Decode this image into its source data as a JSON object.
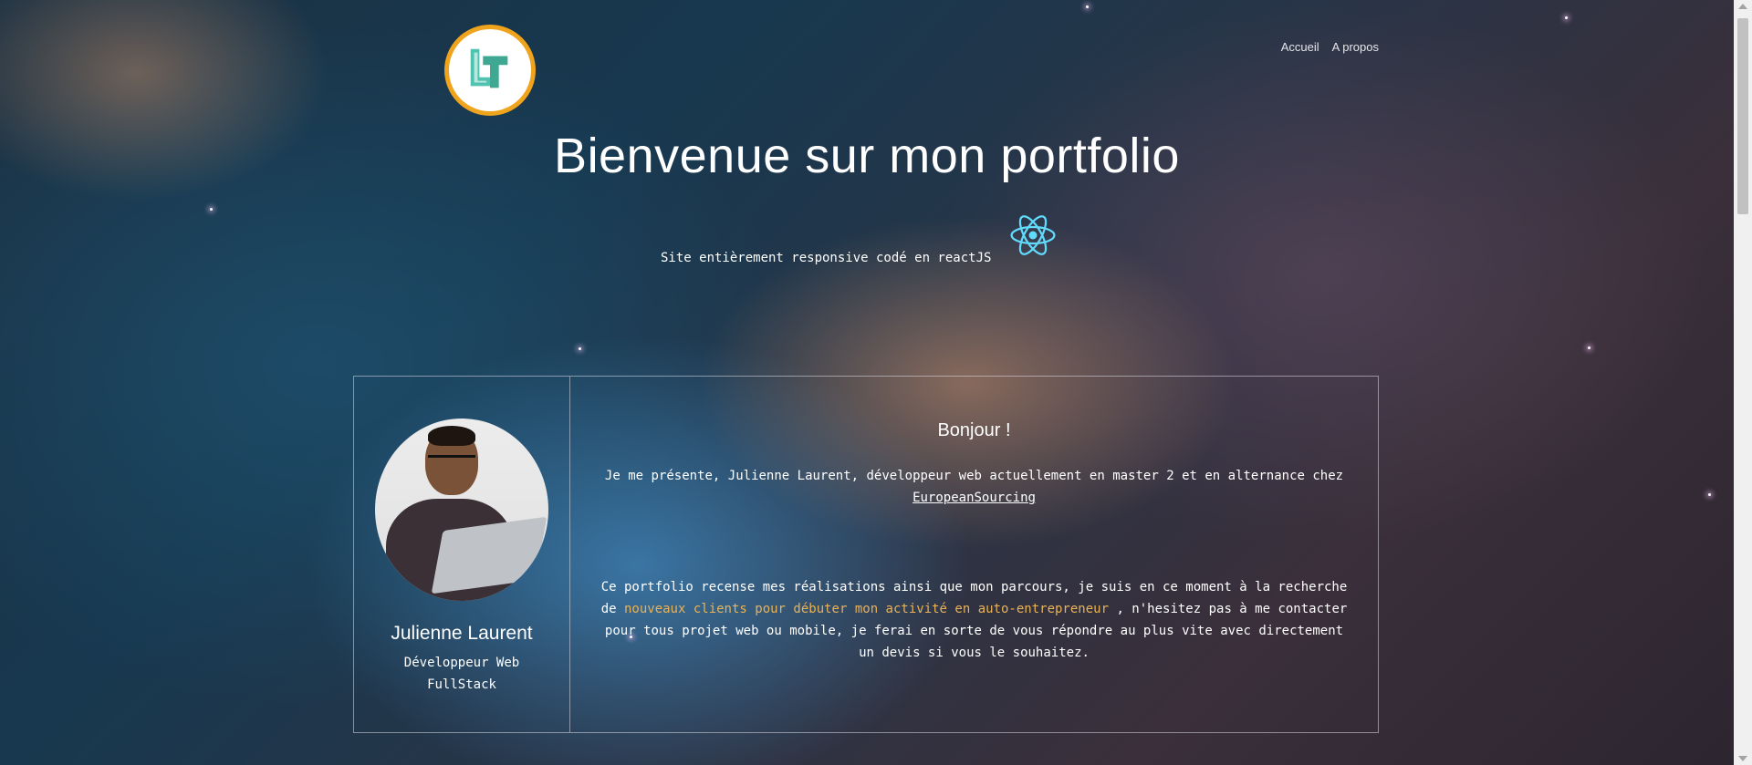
{
  "header": {
    "logo_icon": "lt-monogram-logo",
    "nav": [
      {
        "label": "Accueil"
      },
      {
        "label": "A propos"
      }
    ]
  },
  "hero": {
    "title": "Bienvenue sur mon portfolio",
    "subtitle": "Site entièrement responsive codé en reactJS",
    "tech_icon": "react-atom-icon"
  },
  "profile": {
    "name": "Julienne Laurent",
    "role": "Développeur Web FullStack"
  },
  "about": {
    "greeting": "Bonjour !",
    "intro_text": "Je me présente, Julienne Laurent, développeur web actuellement en master 2 et en alternance chez",
    "company": "EuropeanSourcing",
    "paragraph_start": "Ce portfolio recense mes réalisations ainsi que mon parcours, je suis en ce moment à la recherche de",
    "highlight": "nouveaux clients pour débuter mon activité en auto-entrepreneur",
    "paragraph_end": ", n'hesitez pas à me contacter pour tous projet web ou mobile, je ferai en sorte de vous répondre au plus vite avec directement un devis si vous le souhaitez."
  },
  "colors": {
    "logo_ring": "#f0a31c",
    "logo_mark": "#3fbfa0",
    "react_blue": "#61dafb",
    "highlight": "#e8b257"
  }
}
